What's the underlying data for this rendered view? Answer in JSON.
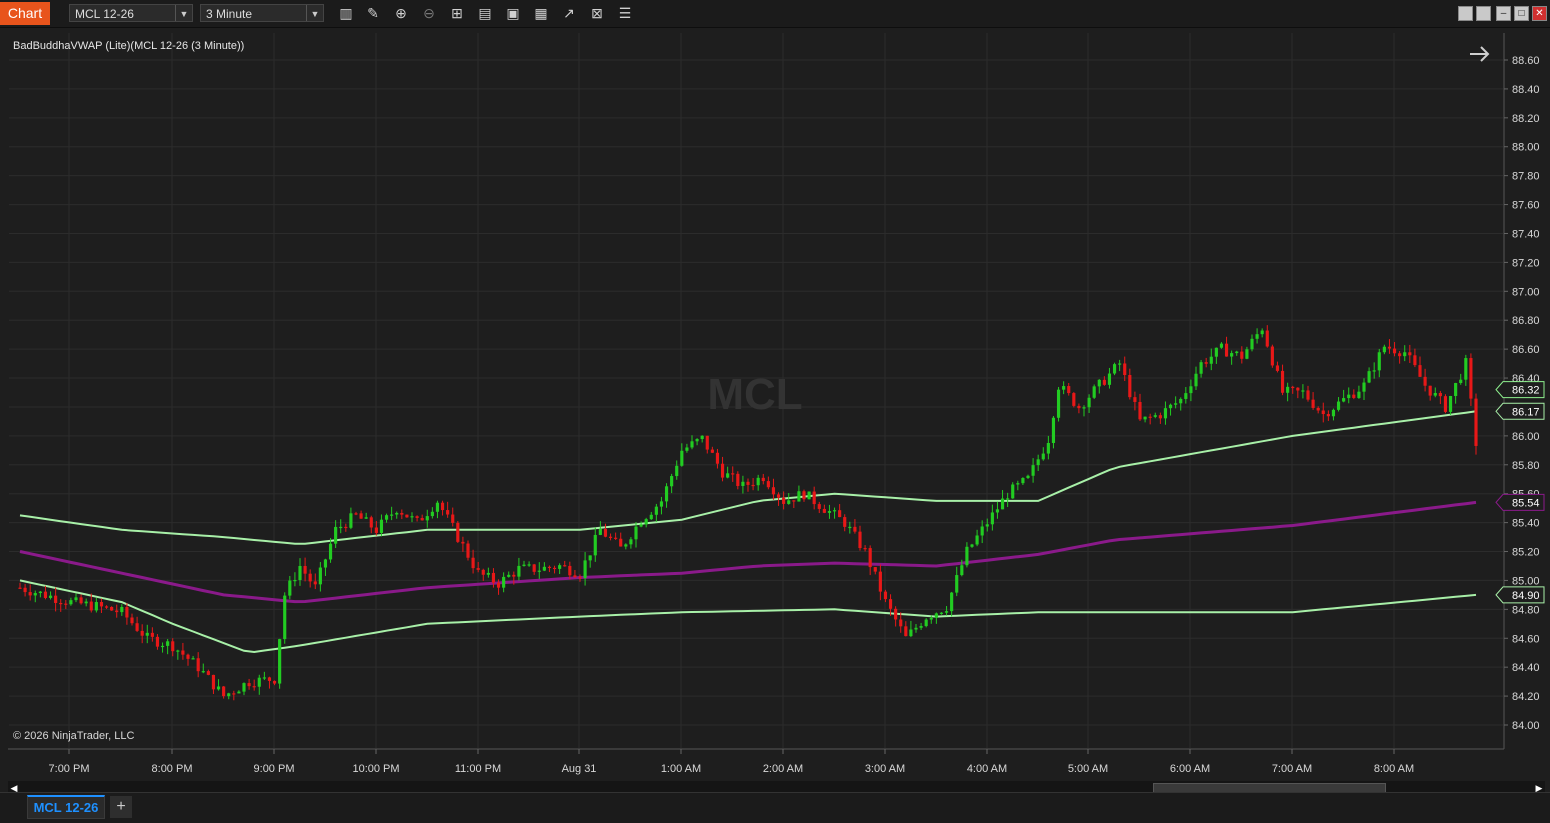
{
  "toolbar": {
    "window_label": "Chart",
    "instrument": "MCL 12-26",
    "interval": "3 Minute",
    "icons": [
      "bar-type-icon",
      "draw-pencil-icon",
      "zoom-in-icon",
      "zoom-out-icon",
      "crosshair-icon",
      "data-box-icon",
      "template-icon",
      "strategies-icon",
      "indicators-icon",
      "chart-trader-icon",
      "properties-icon"
    ]
  },
  "chart": {
    "indicator_label": "BadBuddhaVWAP (Lite)(MCL 12-26 (3 Minute))",
    "watermark": "MCL",
    "copyright": "© 2026 NinjaTrader, LLC",
    "price_labels": [
      "88.60",
      "88.40",
      "88.20",
      "88.00",
      "87.80",
      "87.60",
      "87.40",
      "87.20",
      "87.00",
      "86.80",
      "86.60",
      "86.40",
      "86.20",
      "86.00",
      "85.80",
      "85.60",
      "85.40",
      "85.20",
      "85.00",
      "84.80",
      "84.60",
      "84.40",
      "84.20",
      "84.00"
    ],
    "time_labels": [
      "7:00 PM",
      "8:00 PM",
      "9:00 PM",
      "10:00 PM",
      "11:00 PM",
      "Aug 31",
      "1:00 AM",
      "2:00 AM",
      "3:00 AM",
      "4:00 AM",
      "5:00 AM",
      "6:00 AM",
      "7:00 AM",
      "8:00 AM"
    ],
    "markers": [
      {
        "value": "86.32",
        "color": "#8ef08e"
      },
      {
        "value": "86.17",
        "color": "#a8f0a8"
      },
      {
        "value": "85.54",
        "color": "#8a1a8a"
      },
      {
        "value": "84.90",
        "color": "#a8f0a8"
      }
    ],
    "colors": {
      "up": "#22cc22",
      "down": "#e81818",
      "vwap": "#8a1a8a",
      "band": "#a8f0a8",
      "grid": "#2c2c2c",
      "background": "#1e1e1e"
    }
  },
  "chart_data": {
    "type": "candlestick",
    "ylim": [
      84.0,
      88.6
    ],
    "candles_close_path": [
      [
        0,
        84.95
      ],
      [
        5,
        84.9
      ],
      [
        10,
        84.85
      ],
      [
        15,
        84.82
      ],
      [
        20,
        84.78
      ],
      [
        25,
        84.6
      ],
      [
        30,
        84.55
      ],
      [
        35,
        84.4
      ],
      [
        40,
        84.2
      ],
      [
        45,
        84.3
      ],
      [
        50,
        84.32
      ],
      [
        52,
        84.9
      ],
      [
        55,
        85.1
      ],
      [
        58,
        84.95
      ],
      [
        62,
        85.35
      ],
      [
        66,
        85.45
      ],
      [
        70,
        85.35
      ],
      [
        74,
        85.5
      ],
      [
        78,
        85.4
      ],
      [
        82,
        85.55
      ],
      [
        86,
        85.3
      ],
      [
        90,
        85.05
      ],
      [
        94,
        84.98
      ],
      [
        98,
        85.08
      ],
      [
        102,
        85.08
      ],
      [
        106,
        85.1
      ],
      [
        110,
        85.05
      ],
      [
        114,
        85.35
      ],
      [
        118,
        85.22
      ],
      [
        122,
        85.42
      ],
      [
        126,
        85.55
      ],
      [
        130,
        85.9
      ],
      [
        134,
        85.98
      ],
      [
        138,
        85.75
      ],
      [
        142,
        85.65
      ],
      [
        146,
        85.72
      ],
      [
        150,
        85.55
      ],
      [
        154,
        85.6
      ],
      [
        158,
        85.5
      ],
      [
        162,
        85.4
      ],
      [
        166,
        85.2
      ],
      [
        170,
        84.85
      ],
      [
        174,
        84.6
      ],
      [
        178,
        84.75
      ],
      [
        182,
        84.82
      ],
      [
        186,
        85.2
      ],
      [
        190,
        85.4
      ],
      [
        194,
        85.6
      ],
      [
        198,
        85.7
      ],
      [
        202,
        85.98
      ],
      [
        204,
        86.35
      ],
      [
        208,
        86.2
      ],
      [
        212,
        86.35
      ],
      [
        216,
        86.5
      ],
      [
        220,
        86.1
      ],
      [
        224,
        86.15
      ],
      [
        228,
        86.25
      ],
      [
        232,
        86.5
      ],
      [
        236,
        86.6
      ],
      [
        240,
        86.55
      ],
      [
        244,
        86.75
      ],
      [
        248,
        86.3
      ],
      [
        252,
        86.3
      ],
      [
        256,
        86.15
      ],
      [
        260,
        86.25
      ],
      [
        264,
        86.35
      ],
      [
        268,
        86.62
      ],
      [
        272,
        86.58
      ],
      [
        276,
        86.35
      ],
      [
        280,
        86.2
      ],
      [
        284,
        86.5
      ],
      [
        286,
        85.95
      ]
    ],
    "vwap": [
      [
        0,
        85.2
      ],
      [
        20,
        85.05
      ],
      [
        40,
        84.9
      ],
      [
        55,
        84.85
      ],
      [
        80,
        84.95
      ],
      [
        110,
        85.02
      ],
      [
        130,
        85.05
      ],
      [
        145,
        85.1
      ],
      [
        160,
        85.12
      ],
      [
        180,
        85.1
      ],
      [
        200,
        85.18
      ],
      [
        215,
        85.28
      ],
      [
        250,
        85.38
      ],
      [
        286,
        85.54
      ]
    ],
    "upper_band": [
      [
        0,
        85.45
      ],
      [
        20,
        85.35
      ],
      [
        40,
        85.3
      ],
      [
        55,
        85.25
      ],
      [
        80,
        85.35
      ],
      [
        110,
        85.35
      ],
      [
        130,
        85.42
      ],
      [
        145,
        85.55
      ],
      [
        160,
        85.6
      ],
      [
        180,
        85.55
      ],
      [
        200,
        85.55
      ],
      [
        215,
        85.78
      ],
      [
        250,
        86.0
      ],
      [
        286,
        86.17
      ]
    ],
    "lower_band": [
      [
        0,
        85.0
      ],
      [
        20,
        84.85
      ],
      [
        30,
        84.7
      ],
      [
        45,
        84.5
      ],
      [
        55,
        84.55
      ],
      [
        80,
        84.7
      ],
      [
        110,
        84.75
      ],
      [
        130,
        84.78
      ],
      [
        160,
        84.8
      ],
      [
        180,
        84.75
      ],
      [
        200,
        84.78
      ],
      [
        250,
        84.78
      ],
      [
        286,
        84.9
      ]
    ]
  },
  "bottom": {
    "tab_label": "MCL 12-26",
    "add_tab_label": "+"
  }
}
